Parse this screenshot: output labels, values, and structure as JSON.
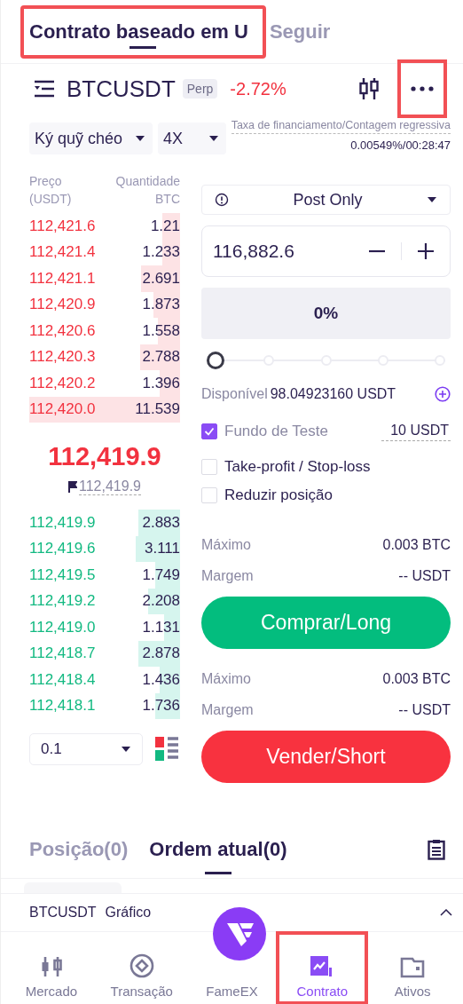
{
  "tabs": [
    {
      "label": "Contrato baseado em U",
      "selected": true,
      "highlighted": true
    },
    {
      "label": "Seguir",
      "selected": false,
      "highlighted": false
    }
  ],
  "header": {
    "symbol": "BTCUSDT",
    "badge": "Perp",
    "change": "-2.72%",
    "more_highlighted": true
  },
  "margin_mode": "Ký quỹ chéo",
  "leverage": "4X",
  "funding": {
    "label": "Taxa de financiamento/Contagem regressiva",
    "value": "0.00549%/00:28:47"
  },
  "orderbook": {
    "price_header": "Preço",
    "price_unit": "(USDT)",
    "qty_header": "Quantidade",
    "qty_unit": "BTC",
    "asks": [
      {
        "price": "112,421.6",
        "qty": "1.21"
      },
      {
        "price": "112,421.4",
        "qty": "1.233"
      },
      {
        "price": "112,421.1",
        "qty": "2.691"
      },
      {
        "price": "112,420.9",
        "qty": "1.873"
      },
      {
        "price": "112,420.6",
        "qty": "1.558"
      },
      {
        "price": "112,420.3",
        "qty": "2.788"
      },
      {
        "price": "112,420.2",
        "qty": "1.396"
      },
      {
        "price": "112,420.0",
        "qty": "11.539"
      }
    ],
    "last_price": "112,419.9",
    "mark_price": "112,419.9",
    "bids": [
      {
        "price": "112,419.9",
        "qty": "2.883"
      },
      {
        "price": "112,419.6",
        "qty": "3.111"
      },
      {
        "price": "112,419.5",
        "qty": "1.749"
      },
      {
        "price": "112,419.2",
        "qty": "2.208"
      },
      {
        "price": "112,419.0",
        "qty": "1.131"
      },
      {
        "price": "112,418.7",
        "qty": "2.878"
      },
      {
        "price": "112,418.4",
        "qty": "1.436"
      },
      {
        "price": "112,418.1",
        "qty": "1.736"
      }
    ],
    "precision": "0.1"
  },
  "order": {
    "type": "Post Only",
    "price": "116,882.6",
    "amount": "0%",
    "slider": {
      "level": 0
    },
    "available_label": "Disponível",
    "available": "98.04923160 USDT",
    "options": [
      {
        "label": "Fundo de Teste",
        "checked": true,
        "value": "10 USDT"
      },
      {
        "label": "Take-profit / Stop-loss",
        "checked": false
      },
      {
        "label": "Reduzir posição",
        "checked": false
      }
    ],
    "actions": [
      {
        "kind": "buy",
        "max_label": "Máximo",
        "max": "0.003 BTC",
        "margin_label": "Margem",
        "margin": "-- USDT",
        "button": "Comprar/Long"
      },
      {
        "kind": "sell",
        "max_label": "Máximo",
        "max": "0.003 BTC",
        "margin_label": "Margem",
        "margin": "-- USDT",
        "button": "Vender/Short"
      }
    ]
  },
  "bottom_tabs": [
    {
      "label": "Posição(0)",
      "selected": false
    },
    {
      "label": "Ordem atual(0)",
      "selected": true
    }
  ],
  "chart_bar": {
    "symbol": "BTCUSDT",
    "label": "Gráfico"
  },
  "nav": [
    {
      "label": "Mercado",
      "selected": false,
      "highlighted": false
    },
    {
      "label": "Transação",
      "selected": false,
      "highlighted": false
    },
    {
      "label": "FameEX",
      "selected": false,
      "highlighted": false
    },
    {
      "label": "Contrato",
      "selected": true,
      "highlighted": true
    },
    {
      "label": "Ativos",
      "selected": false,
      "highlighted": false
    }
  ]
}
